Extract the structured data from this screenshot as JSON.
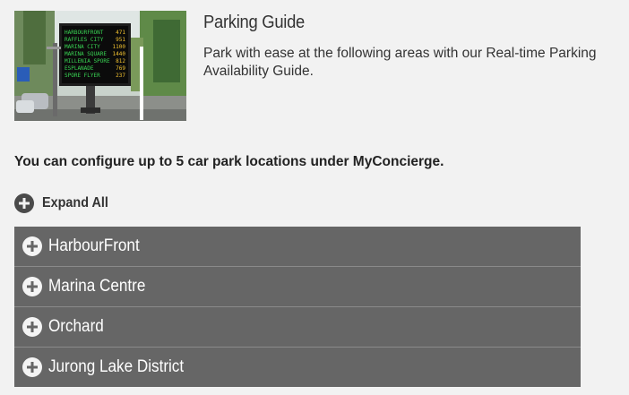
{
  "colors": {
    "page_background": "#f2f2f2",
    "accordion_background": "#666666",
    "accordion_text": "#ffffff",
    "icon_dark": "#4a4a4a"
  },
  "hero": {
    "image": "parking-availability-sign-photo",
    "sign_lines": [
      {
        "name": "HARBOURFRONT",
        "value": "471"
      },
      {
        "name": "RAFFLES CITY",
        "value": "951"
      },
      {
        "name": "MARINA CITY",
        "value": "1100"
      },
      {
        "name": "MARINA SQUARE",
        "value": "1440"
      },
      {
        "name": "MILLENIA SPORE",
        "value": "812"
      },
      {
        "name": "ESPLANADE",
        "value": "769"
      },
      {
        "name": "SPORE FLYER",
        "value": "237"
      }
    ]
  },
  "header": {
    "title": "Parking Guide",
    "description": "Park with ease at the following areas with our Real-time Parking Availability Guide."
  },
  "notice": "You can configure up to 5 car park locations under MyConcierge.",
  "expand_all": {
    "label": "Expand All",
    "icon": "plus-circle-icon"
  },
  "accordion": {
    "icon": "plus-circle-icon",
    "items": [
      {
        "label": "HarbourFront"
      },
      {
        "label": "Marina Centre"
      },
      {
        "label": "Orchard"
      },
      {
        "label": "Jurong Lake District"
      }
    ]
  }
}
